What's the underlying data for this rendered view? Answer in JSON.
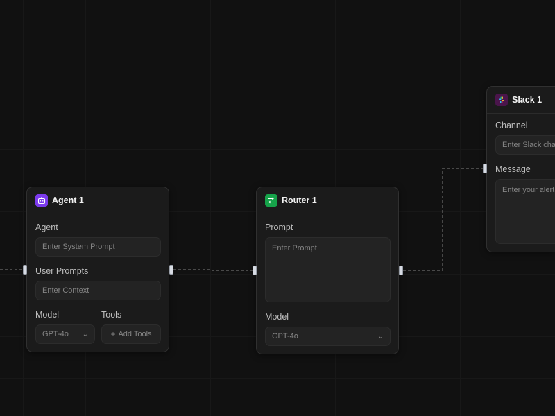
{
  "colors": {
    "agent_icon_bg": "#7c3aed",
    "router_icon_bg": "#16a34a",
    "slack_icon_bg": "#4a154b"
  },
  "nodes": {
    "agent": {
      "title": "Agent 1",
      "icon": "robot-icon",
      "agent_label": "Agent",
      "agent_placeholder": "Enter System Prompt",
      "user_prompts_label": "User Prompts",
      "user_prompts_placeholder": "Enter Context",
      "model_label": "Model",
      "model_value": "GPT-4o",
      "tools_label": "Tools",
      "add_tools_label": "Add Tools"
    },
    "router": {
      "title": "Router 1",
      "icon": "router-icon",
      "prompt_label": "Prompt",
      "prompt_placeholder": "Enter Prompt",
      "model_label": "Model",
      "model_value": "GPT-4o"
    },
    "slack": {
      "title": "Slack 1",
      "icon": "slack-icon",
      "channel_label": "Channel",
      "channel_placeholder": "Enter Slack chan",
      "message_label": "Message",
      "message_placeholder": "Enter your alert m"
    }
  }
}
